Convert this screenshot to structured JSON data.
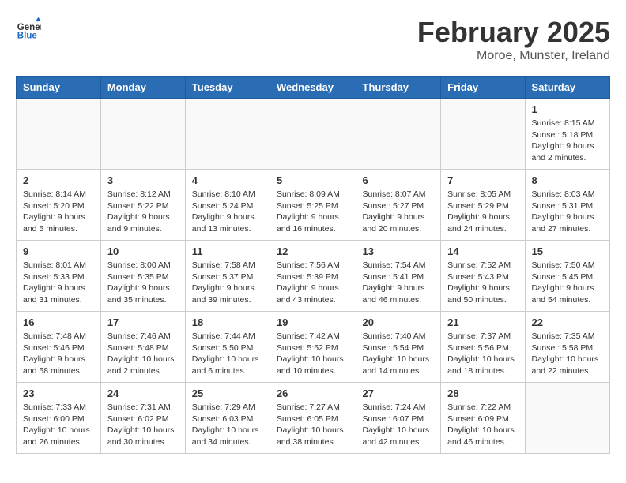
{
  "logo": {
    "general": "General",
    "blue": "Blue"
  },
  "title": "February 2025",
  "location": "Moroe, Munster, Ireland",
  "days_of_week": [
    "Sunday",
    "Monday",
    "Tuesday",
    "Wednesday",
    "Thursday",
    "Friday",
    "Saturday"
  ],
  "weeks": [
    [
      {
        "day": "",
        "info": ""
      },
      {
        "day": "",
        "info": ""
      },
      {
        "day": "",
        "info": ""
      },
      {
        "day": "",
        "info": ""
      },
      {
        "day": "",
        "info": ""
      },
      {
        "day": "",
        "info": ""
      },
      {
        "day": "1",
        "info": "Sunrise: 8:15 AM\nSunset: 5:18 PM\nDaylight: 9 hours and 2 minutes."
      }
    ],
    [
      {
        "day": "2",
        "info": "Sunrise: 8:14 AM\nSunset: 5:20 PM\nDaylight: 9 hours and 5 minutes."
      },
      {
        "day": "3",
        "info": "Sunrise: 8:12 AM\nSunset: 5:22 PM\nDaylight: 9 hours and 9 minutes."
      },
      {
        "day": "4",
        "info": "Sunrise: 8:10 AM\nSunset: 5:24 PM\nDaylight: 9 hours and 13 minutes."
      },
      {
        "day": "5",
        "info": "Sunrise: 8:09 AM\nSunset: 5:25 PM\nDaylight: 9 hours and 16 minutes."
      },
      {
        "day": "6",
        "info": "Sunrise: 8:07 AM\nSunset: 5:27 PM\nDaylight: 9 hours and 20 minutes."
      },
      {
        "day": "7",
        "info": "Sunrise: 8:05 AM\nSunset: 5:29 PM\nDaylight: 9 hours and 24 minutes."
      },
      {
        "day": "8",
        "info": "Sunrise: 8:03 AM\nSunset: 5:31 PM\nDaylight: 9 hours and 27 minutes."
      }
    ],
    [
      {
        "day": "9",
        "info": "Sunrise: 8:01 AM\nSunset: 5:33 PM\nDaylight: 9 hours and 31 minutes."
      },
      {
        "day": "10",
        "info": "Sunrise: 8:00 AM\nSunset: 5:35 PM\nDaylight: 9 hours and 35 minutes."
      },
      {
        "day": "11",
        "info": "Sunrise: 7:58 AM\nSunset: 5:37 PM\nDaylight: 9 hours and 39 minutes."
      },
      {
        "day": "12",
        "info": "Sunrise: 7:56 AM\nSunset: 5:39 PM\nDaylight: 9 hours and 43 minutes."
      },
      {
        "day": "13",
        "info": "Sunrise: 7:54 AM\nSunset: 5:41 PM\nDaylight: 9 hours and 46 minutes."
      },
      {
        "day": "14",
        "info": "Sunrise: 7:52 AM\nSunset: 5:43 PM\nDaylight: 9 hours and 50 minutes."
      },
      {
        "day": "15",
        "info": "Sunrise: 7:50 AM\nSunset: 5:45 PM\nDaylight: 9 hours and 54 minutes."
      }
    ],
    [
      {
        "day": "16",
        "info": "Sunrise: 7:48 AM\nSunset: 5:46 PM\nDaylight: 9 hours and 58 minutes."
      },
      {
        "day": "17",
        "info": "Sunrise: 7:46 AM\nSunset: 5:48 PM\nDaylight: 10 hours and 2 minutes."
      },
      {
        "day": "18",
        "info": "Sunrise: 7:44 AM\nSunset: 5:50 PM\nDaylight: 10 hours and 6 minutes."
      },
      {
        "day": "19",
        "info": "Sunrise: 7:42 AM\nSunset: 5:52 PM\nDaylight: 10 hours and 10 minutes."
      },
      {
        "day": "20",
        "info": "Sunrise: 7:40 AM\nSunset: 5:54 PM\nDaylight: 10 hours and 14 minutes."
      },
      {
        "day": "21",
        "info": "Sunrise: 7:37 AM\nSunset: 5:56 PM\nDaylight: 10 hours and 18 minutes."
      },
      {
        "day": "22",
        "info": "Sunrise: 7:35 AM\nSunset: 5:58 PM\nDaylight: 10 hours and 22 minutes."
      }
    ],
    [
      {
        "day": "23",
        "info": "Sunrise: 7:33 AM\nSunset: 6:00 PM\nDaylight: 10 hours and 26 minutes."
      },
      {
        "day": "24",
        "info": "Sunrise: 7:31 AM\nSunset: 6:02 PM\nDaylight: 10 hours and 30 minutes."
      },
      {
        "day": "25",
        "info": "Sunrise: 7:29 AM\nSunset: 6:03 PM\nDaylight: 10 hours and 34 minutes."
      },
      {
        "day": "26",
        "info": "Sunrise: 7:27 AM\nSunset: 6:05 PM\nDaylight: 10 hours and 38 minutes."
      },
      {
        "day": "27",
        "info": "Sunrise: 7:24 AM\nSunset: 6:07 PM\nDaylight: 10 hours and 42 minutes."
      },
      {
        "day": "28",
        "info": "Sunrise: 7:22 AM\nSunset: 6:09 PM\nDaylight: 10 hours and 46 minutes."
      },
      {
        "day": "",
        "info": ""
      }
    ]
  ]
}
